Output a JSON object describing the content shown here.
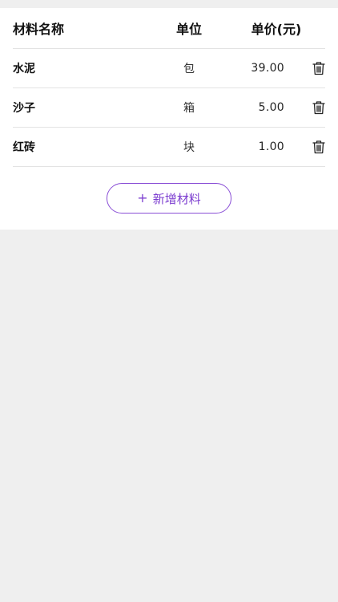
{
  "table": {
    "headers": {
      "name": "材料名称",
      "unit": "单位",
      "price": "单价(元)"
    },
    "rows": [
      {
        "name": "水泥",
        "unit": "包",
        "price": "39.00"
      },
      {
        "name": "沙子",
        "unit": "箱",
        "price": "5.00"
      },
      {
        "name": "红砖",
        "unit": "块",
        "price": "1.00"
      }
    ],
    "delete_icon": "trash-icon"
  },
  "add_button": {
    "icon": "+",
    "label": "新增材料"
  },
  "colors": {
    "accent": "#7d3fd0",
    "background": "#efefef",
    "card": "#ffffff",
    "divider": "#e3e3e3"
  }
}
